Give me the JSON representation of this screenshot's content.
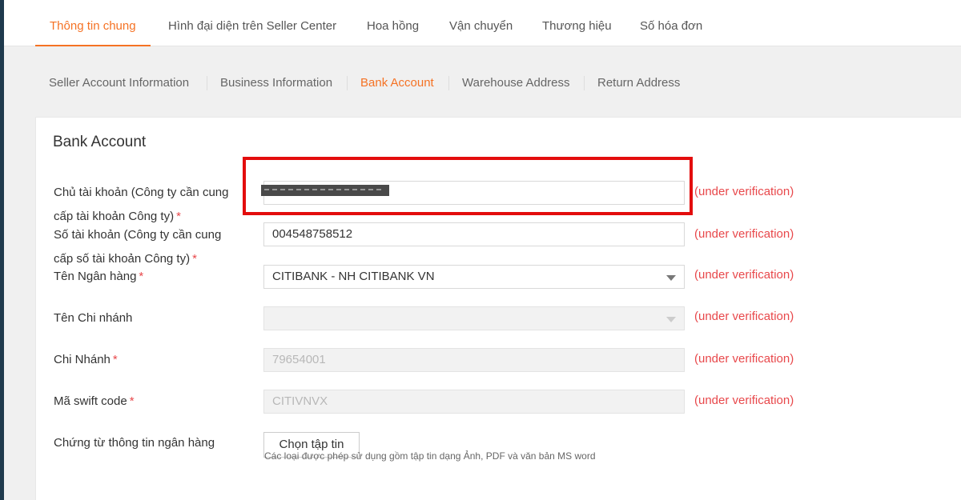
{
  "top_tabs": [
    {
      "label": "Thông tin chung",
      "active": true
    },
    {
      "label": "Hình đại diện trên Seller Center",
      "active": false
    },
    {
      "label": "Hoa hồng",
      "active": false
    },
    {
      "label": "Vận chuyển",
      "active": false
    },
    {
      "label": "Thương hiệu",
      "active": false
    },
    {
      "label": "Số hóa đơn",
      "active": false
    }
  ],
  "sub_tabs": [
    {
      "label": "Seller Account Information",
      "active": false
    },
    {
      "label": "Business Information",
      "active": false
    },
    {
      "label": "Bank Account",
      "active": true
    },
    {
      "label": "Warehouse Address",
      "active": false
    },
    {
      "label": "Return Address",
      "active": false
    }
  ],
  "panel": {
    "title": "Bank Account",
    "required_mark": "*",
    "verification_text": "(under verification)",
    "fields": {
      "account_holder": {
        "label_line1": "Chủ tài khoản (Công ty cần cung",
        "label_line2": "cấp tài khoản Công ty)",
        "value": ""
      },
      "account_number": {
        "label_line1": "Số tài khoản (Công ty cần cung",
        "label_line2": "cấp số tài khoản Công ty)",
        "value": "004548758512"
      },
      "bank_name": {
        "label": "Tên Ngân hàng",
        "value": "CITIBANK - NH CITIBANK VN"
      },
      "branch_name": {
        "label": "Tên Chi nhánh",
        "value": ""
      },
      "branch": {
        "label": "Chi Nhánh",
        "value": "79654001"
      },
      "swift_code": {
        "label": "Mã swift code",
        "value": "CITIVNVX"
      },
      "bank_document": {
        "label": "Chứng từ thông tin ngân hàng",
        "button": "Chọn tập tin",
        "help": "Các loại được phép sử dụng gồm tập tin dạng Ảnh, PDF và văn bản MS word"
      }
    }
  },
  "colors": {
    "accent": "#f57224",
    "error": "#e8484b",
    "highlight": "#e30d0d"
  }
}
